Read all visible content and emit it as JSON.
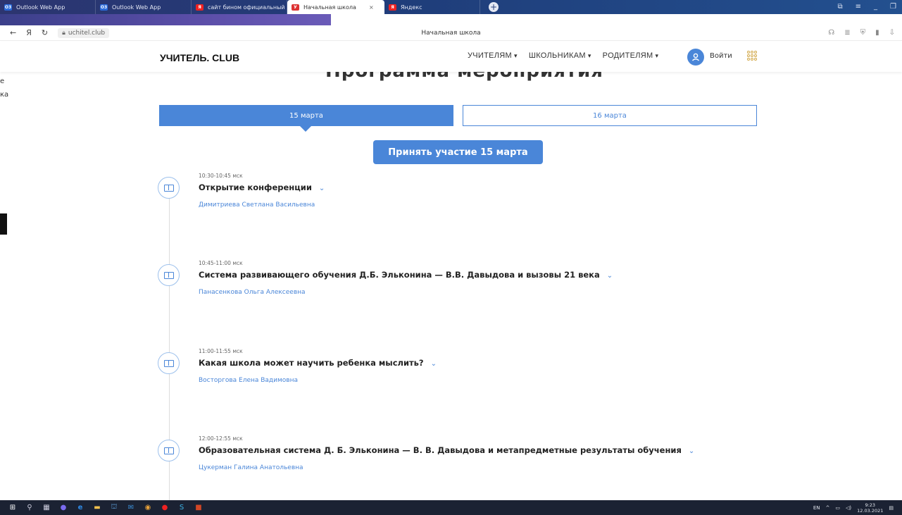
{
  "browser": {
    "tabs": [
      {
        "label": "Outlook Web App",
        "favicon": "O3",
        "color": "#2a6ad9"
      },
      {
        "label": "Outlook Web App",
        "favicon": "O3",
        "color": "#2a6ad9"
      },
      {
        "label": "сайт бином официальный",
        "favicon": "Я",
        "color": "#e22"
      },
      {
        "label": "Начальная школа",
        "favicon": "У",
        "color": "#d33",
        "active": true
      },
      {
        "label": "Яндекс",
        "favicon": "Я",
        "color": "#e22"
      }
    ],
    "address": "uchitel.club",
    "page_title": "Начальная школа",
    "nav_icons": [
      "←",
      "Я",
      "↻"
    ]
  },
  "background_fragments": [
    "е",
    "ка"
  ],
  "site": {
    "logo_main": "УЧИТЕЛЬ.",
    "logo_club": "CLUB",
    "menu": [
      "УЧИТЕЛЯМ",
      "ШКОЛЬНИКАМ",
      "РОДИТЕЛЯМ"
    ],
    "login": "Войти",
    "section_title": "Программа мероприятия"
  },
  "date_tabs": {
    "active": "15 марта",
    "inactive": "16 марта"
  },
  "cta_label": "Принять участие 15 марта",
  "events": [
    {
      "time": "10:30-10:45 мск",
      "title": "Открытие конференции",
      "speaker": "Димитриева Светлана Васильевна"
    },
    {
      "time": "10:45-11:00 мск",
      "title": "Система развивающего обучения Д.Б. Эльконина — В.В. Давыдова и вызовы 21 века",
      "speaker": "Панасенкова Ольга Алексеевна"
    },
    {
      "time": "11:00-11:55 мск",
      "title": "Какая школа может научить ребенка мыслить?",
      "speaker": "Восторгова Елена Вадимовна"
    },
    {
      "time": "12:00-12:55 мск",
      "title": "Образовательная система Д. Б. Эльконина — В. В. Давыдова и метапредметные результаты обучения",
      "speaker": "Цукерман Галина Анатольевна"
    }
  ],
  "taskbar": {
    "lang": "EN",
    "time": "9:23",
    "date": "12.03.2021"
  }
}
